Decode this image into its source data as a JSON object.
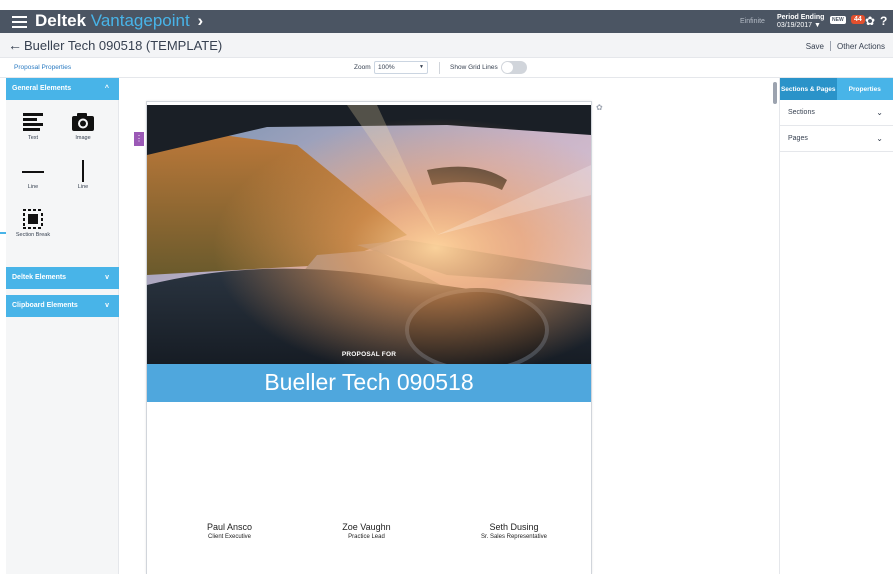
{
  "topbar": {
    "brand_part1": "Deltek",
    "brand_part2": "Vantagepoint",
    "brand_chevron": "›",
    "user_label": "Einfinite",
    "period_label": "Period Ending",
    "period_value": "03/19/2017 ▼",
    "new_badge": "NEW",
    "notification_count": "44",
    "help_label": "?"
  },
  "titlebar": {
    "title": "Bueller Tech 090518  (TEMPLATE)",
    "save_label": "Save",
    "other_actions_label": "Other Actions"
  },
  "toolbar": {
    "proposal_properties_label": "Proposal Properties",
    "zoom_label": "Zoom",
    "zoom_value": "100%",
    "show_grid_lines_label": "Show Grid Lines"
  },
  "left_panel": {
    "general_elements_label": "General Elements",
    "elements": [
      {
        "label": "Text",
        "icon": "text-align-icon"
      },
      {
        "label": "Image",
        "icon": "camera-icon"
      },
      {
        "label": "Line",
        "icon": "horizontal-line-icon"
      },
      {
        "label": "Line",
        "icon": "vertical-line-icon"
      },
      {
        "label": "Section Break",
        "icon": "section-break-icon"
      }
    ],
    "deltek_elements_label": "Deltek Elements",
    "clipboard_elements_label": "Clipboard Elements"
  },
  "page": {
    "proposal_for": "PROPOSAL FOR",
    "client_name": "Bueller Tech 090518",
    "people": [
      {
        "name": "Paul Ansco",
        "role": "Client Executive"
      },
      {
        "name": "Zoe Vaughn",
        "role": "Practice Lead"
      },
      {
        "name": "Seth Dusing",
        "role": "Sr. Sales Representative"
      }
    ]
  },
  "right_panel": {
    "tab_sections_pages": "Sections & Pages",
    "tab_properties": "Properties",
    "sections_label": "Sections",
    "pages_label": "Pages"
  },
  "colors": {
    "topbar": "#4b5563",
    "accent": "#48b4e8",
    "banner": "#4fa7dd",
    "badge": "#e2502e"
  }
}
